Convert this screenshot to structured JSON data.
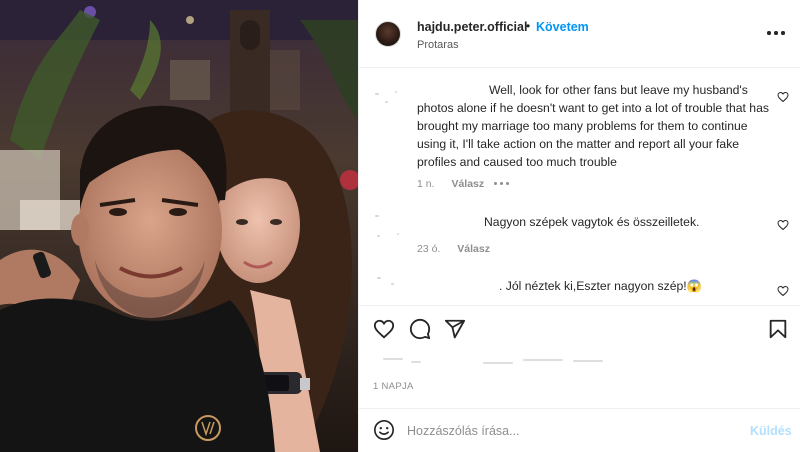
{
  "post": {
    "username": "hajdu.peter.official",
    "separator": "•",
    "follow_label": "Követem",
    "location": "Protaras"
  },
  "comments": [
    {
      "text": "Well, look for other fans but leave my husband's photos alone if he doesn't want to get into a lot of trouble that has brought my marriage too many problems for them to continue using it, I'll take action on the matter and report all your fake profiles and caused too much trouble",
      "time": "1 n.",
      "reply_label": "Válasz"
    },
    {
      "text": "Nagyon szépek vagytok és összeilletek.",
      "time": "23 ó.",
      "reply_label": "Válasz"
    },
    {
      "text": ". Jól néztek ki,Eszter nagyon szép!😱"
    }
  ],
  "footer": {
    "date": "1 NAPJA",
    "comment_placeholder": "Hozzászólás írása...",
    "send_label": "Küldés"
  },
  "icons": {
    "like": "heart-icon",
    "comment": "comment-icon",
    "share": "send-icon",
    "save": "bookmark-icon",
    "emoji": "emoji-icon",
    "more": "more-dots-icon"
  },
  "colors": {
    "accent": "#0095f6",
    "send_disabled": "#b2dffc",
    "secondary_text": "#8e8e8e"
  }
}
